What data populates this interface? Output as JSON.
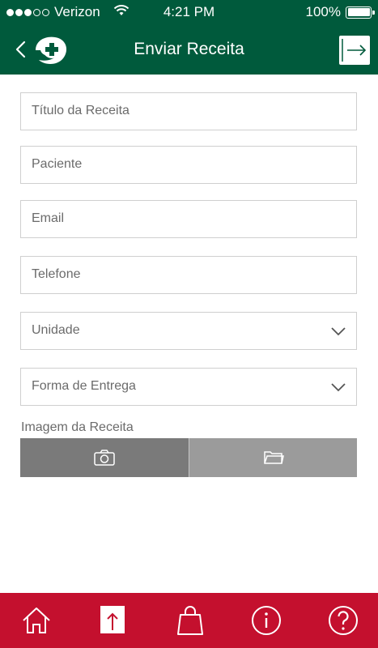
{
  "status_bar": {
    "carrier": "Verizon",
    "time": "4:21 PM",
    "battery": "100%",
    "signal_strength": 3
  },
  "nav": {
    "title": "Enviar Receita",
    "back_icon": "chevron-left-icon",
    "logo_icon": "pharmacy-cross-logo",
    "logout_icon": "logout-arrow-icon"
  },
  "form": {
    "fields": [
      {
        "placeholder": "Título da Receita"
      },
      {
        "placeholder": "Paciente"
      },
      {
        "placeholder": "Email"
      },
      {
        "placeholder": "Telefone"
      }
    ],
    "selects": [
      {
        "value": "Unidade"
      },
      {
        "value": "Forma de Entrega"
      }
    ],
    "image_label": "Imagem da Receita",
    "image_buttons": [
      "camera-icon",
      "folder-icon"
    ]
  },
  "tab_bar": {
    "tabs": [
      "home-icon",
      "upload-icon",
      "shopping-bag-icon",
      "info-icon",
      "help-icon"
    ],
    "active": 1
  },
  "colors": {
    "brand_green": "#005a3c",
    "tab_red": "#c4102e",
    "camera_button": "#7a7a7a",
    "folder_button": "#9b9b9b"
  }
}
